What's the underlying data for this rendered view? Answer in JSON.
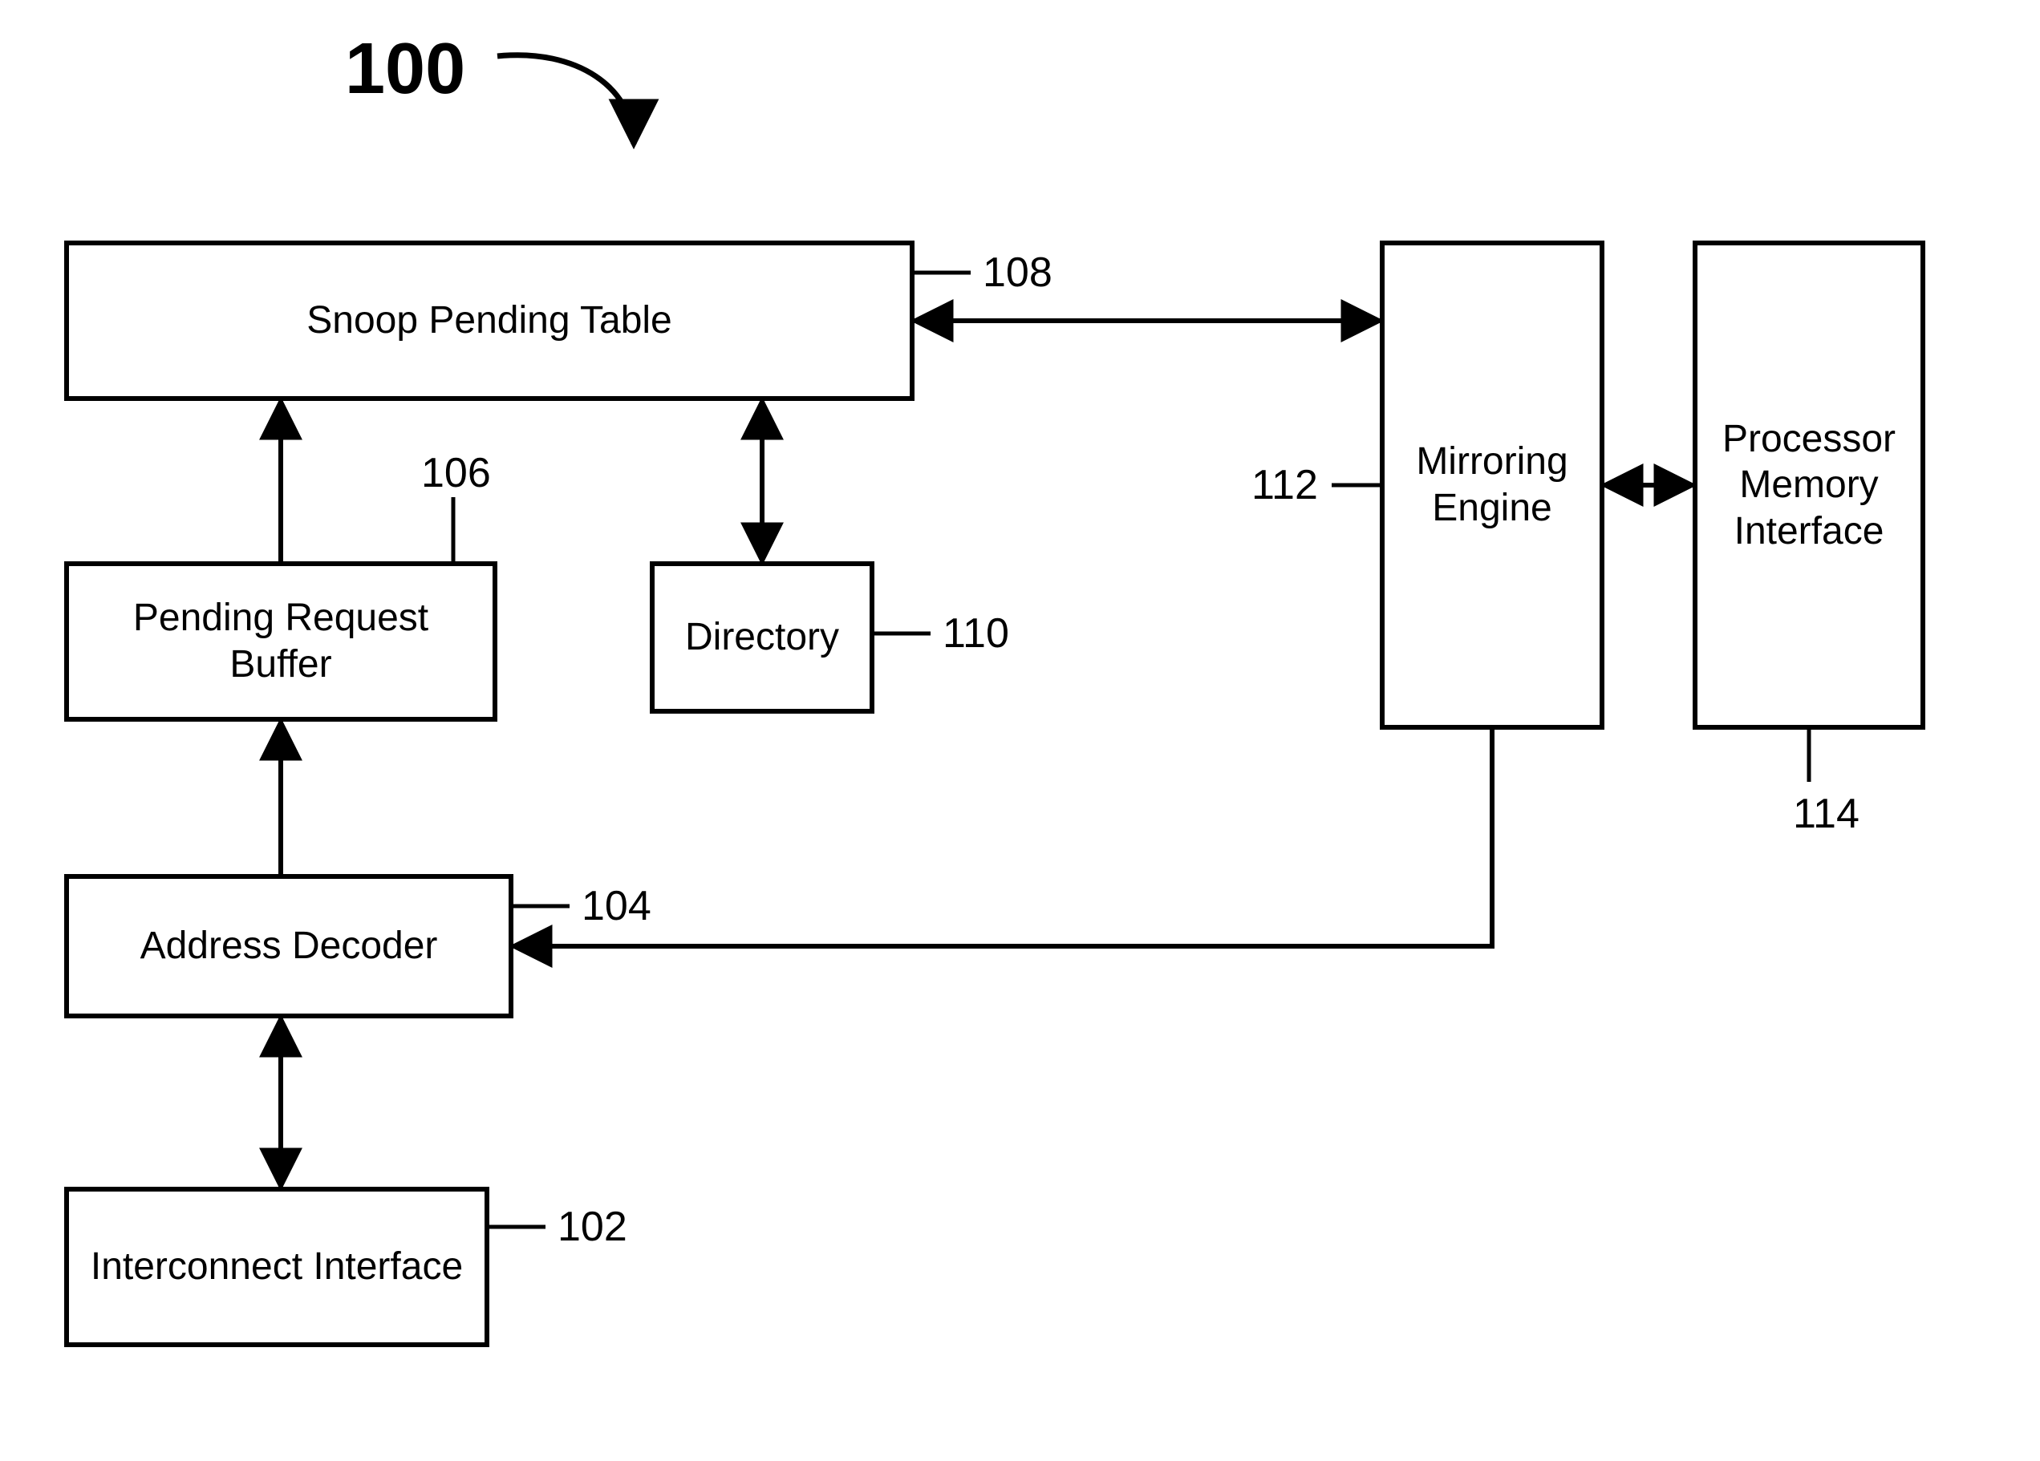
{
  "diagram": {
    "title": "100",
    "blocks": {
      "snoop_pending_table": {
        "label": "Snoop Pending Table",
        "ref": "108"
      },
      "pending_request_buffer": {
        "label": "Pending Request Buffer",
        "ref": "106"
      },
      "directory": {
        "label": "Directory",
        "ref": "110"
      },
      "address_decoder": {
        "label": "Address Decoder",
        "ref": "104"
      },
      "interconnect_interface": {
        "label": "Interconnect Interface",
        "ref": "102"
      },
      "mirroring_engine": {
        "label": "Mirroring Engine",
        "ref": "112"
      },
      "processor_memory_interface": {
        "label": "Processor Memory Interface",
        "ref": "114"
      }
    }
  }
}
